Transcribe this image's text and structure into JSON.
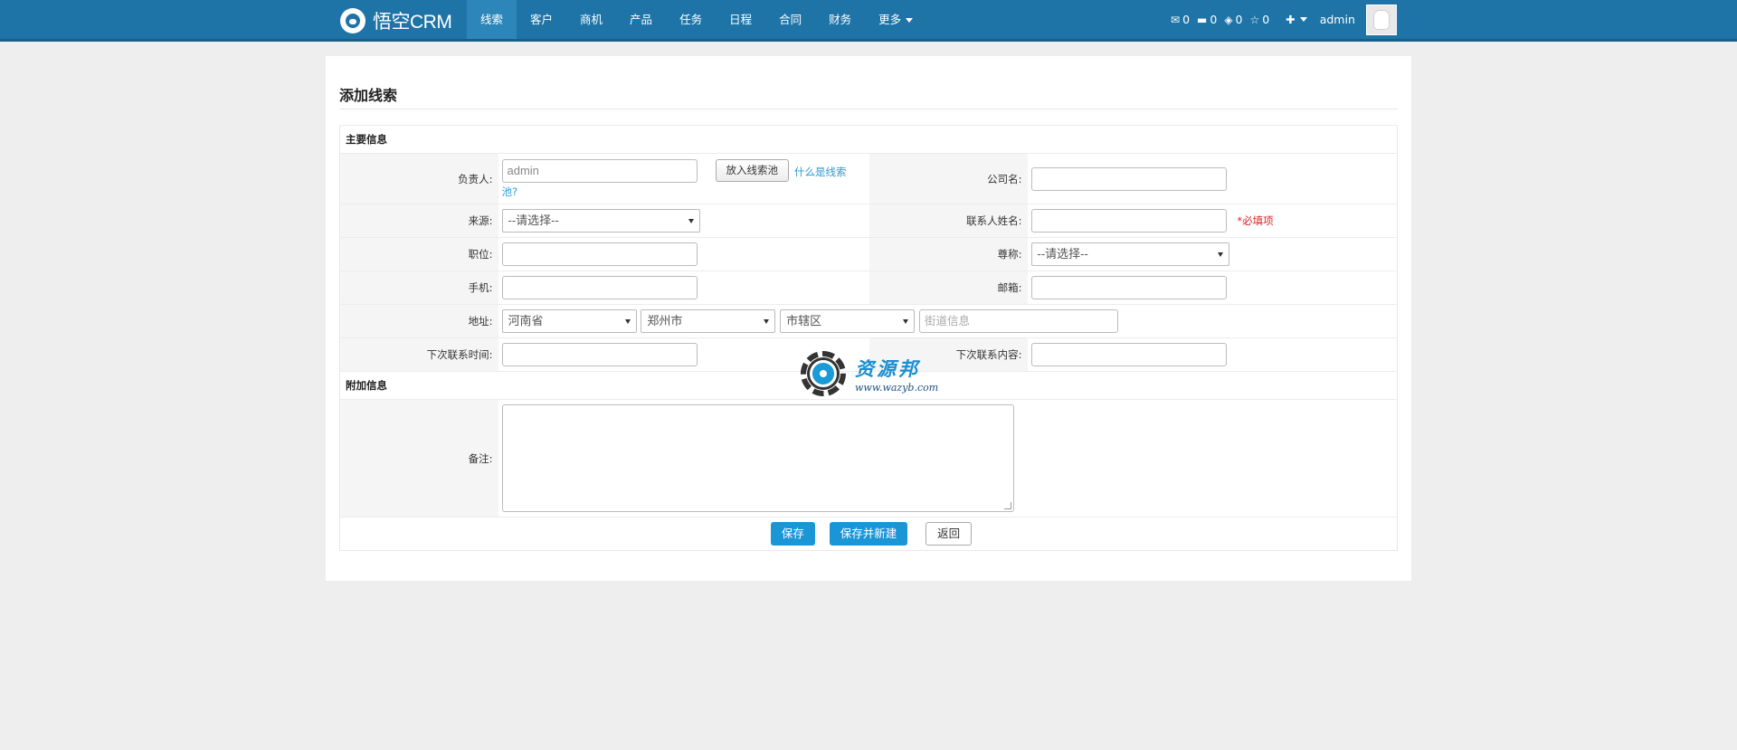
{
  "brand": {
    "name": "悟空CRM"
  },
  "nav": {
    "items": [
      "线索",
      "客户",
      "商机",
      "产品",
      "任务",
      "日程",
      "合同",
      "财务",
      "更多"
    ],
    "active_index": 0
  },
  "nav_right": {
    "mail_count": "0",
    "message_count": "0",
    "task_count": "0",
    "star_count": "0",
    "user": "admin"
  },
  "page": {
    "title": "添加线索"
  },
  "sections": {
    "main": "主要信息",
    "extra": "附加信息"
  },
  "fields": {
    "owner": {
      "label": "负责人:",
      "value": "admin",
      "pool_button": "放入线索池",
      "help_link_1": "什么是线索",
      "help_link_2": "池?"
    },
    "company": {
      "label": "公司名:",
      "value": ""
    },
    "source": {
      "label": "来源:",
      "value": "--请选择--"
    },
    "contact_name": {
      "label": "联系人姓名:",
      "value": "",
      "required_note": "*必填项"
    },
    "position": {
      "label": "职位:",
      "value": ""
    },
    "salutation": {
      "label": "尊称:",
      "value": "--请选择--"
    },
    "mobile": {
      "label": "手机:",
      "value": ""
    },
    "email": {
      "label": "邮箱:",
      "value": ""
    },
    "address": {
      "label": "地址:",
      "province": "河南省",
      "city": "郑州市",
      "district": "市辖区",
      "street_placeholder": "街道信息"
    },
    "next_contact_time": {
      "label": "下次联系时间:",
      "value": ""
    },
    "next_contact_content": {
      "label": "下次联系内容:",
      "value": ""
    },
    "remark": {
      "label": "备注:",
      "value": ""
    }
  },
  "buttons": {
    "save": "保存",
    "save_new": "保存并新建",
    "back": "返回"
  },
  "watermark": {
    "cn": "资源邦",
    "url": "www.wazyb.com"
  },
  "colors": {
    "navbar": "#1f74a7",
    "primary": "#1a96d7",
    "link": "#2a9ad6",
    "required": "#e02020"
  }
}
